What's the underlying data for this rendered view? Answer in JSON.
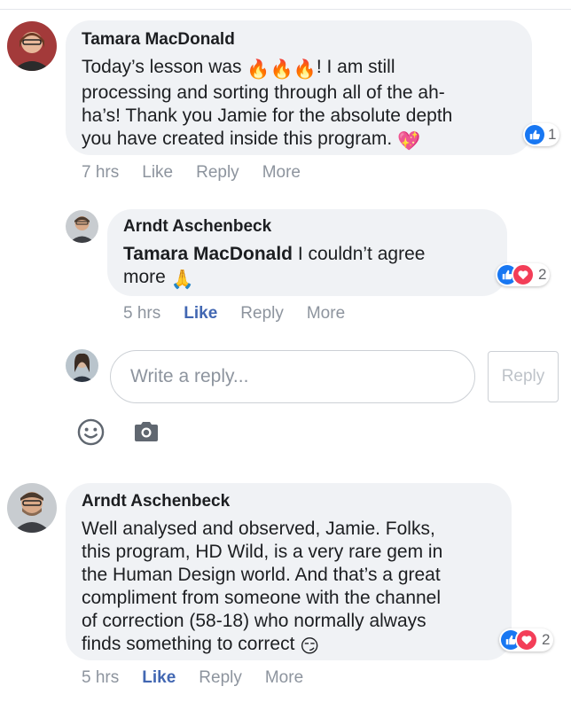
{
  "comments": [
    {
      "author": "Tamara MacDonald",
      "text_before": "Today’s lesson was ",
      "text_emoji": "🔥🔥🔥",
      "text_line1_after": "! I am still",
      "text_line2": "processing and sorting through all of the ah-",
      "text_line3": "ha’s! Thank you Jamie for the absolute depth",
      "text_line4": "you have created inside this program. ",
      "trailing_emoji": "💖",
      "time": "7 hrs",
      "like": "Like",
      "reply": "Reply",
      "more": "More",
      "reaction_count": "1",
      "reactions": [
        "like"
      ]
    },
    {
      "author": "Arndt Aschenbeck",
      "mention": "Tamara MacDonald",
      "text": " I couldn’t agree",
      "text_line2": "more ",
      "trailing_emoji": "🙏",
      "time": "5 hrs",
      "like": "Like",
      "reply": "Reply",
      "more": "More",
      "reaction_count": "2",
      "reactions": [
        "like",
        "love"
      ]
    },
    {
      "author": "Arndt Aschenbeck",
      "lines": [
        "Well analysed and observed, Jamie. Folks,",
        "this program, HD Wild, is a very rare gem in",
        "the Human Design world. And that’s a great",
        "compliment from someone with the channel",
        "of correction (58-18) who normally always"
      ],
      "last_line": "finds something to correct ",
      "trailing_emoji": "😏",
      "time": "5 hrs",
      "like": "Like",
      "reply": "Reply",
      "more": "More",
      "reaction_count": "2",
      "reactions": [
        "like",
        "love"
      ]
    }
  ],
  "reply_box": {
    "placeholder": "Write a reply...",
    "button_label": "Reply"
  },
  "icons": [
    "smiley-icon",
    "camera-icon"
  ],
  "colors": {
    "bubble": "#f0f2f5",
    "like_active": "#4267b2",
    "muted": "#8d949e",
    "like_blue": "#1877f2",
    "love_red": "#f33e58"
  }
}
